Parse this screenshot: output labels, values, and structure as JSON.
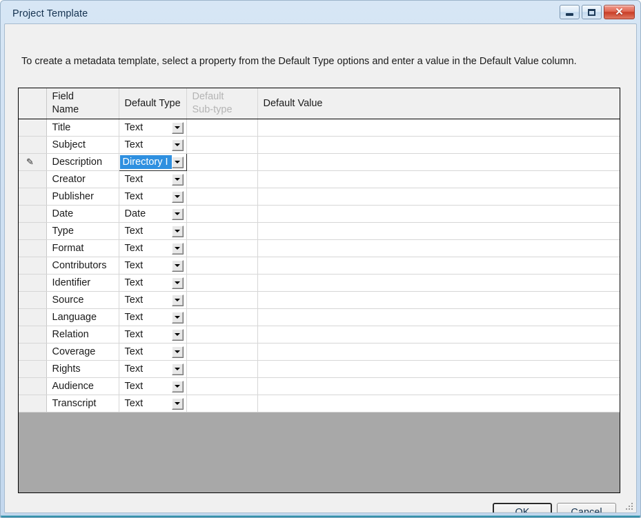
{
  "window": {
    "title": "Project Template",
    "caption_buttons": [
      {
        "name": "minimize-button",
        "glyph": "minimize"
      },
      {
        "name": "maximize-button",
        "glyph": "maximize"
      },
      {
        "name": "close-button",
        "glyph": "✕"
      }
    ]
  },
  "instruction": "To create a metadata template, select a property from the Default Type options and enter a value in the Default Value column.",
  "grid": {
    "columns": [
      {
        "key": "rowhdr",
        "label": "",
        "disabled": false
      },
      {
        "key": "field",
        "label": "Field\nName",
        "line1": "Field",
        "line2": "Name",
        "disabled": false
      },
      {
        "key": "type",
        "label": "Default Type",
        "disabled": false
      },
      {
        "key": "sub",
        "label": "Default Sub-type",
        "line1": "Default",
        "line2": "Sub-type",
        "disabled": true
      },
      {
        "key": "value",
        "label": "Default Value",
        "disabled": false
      }
    ],
    "rows": [
      {
        "field": "Title",
        "type": "Text",
        "sub": "",
        "value": "",
        "editing": false
      },
      {
        "field": "Subject",
        "type": "Text",
        "sub": "",
        "value": "",
        "editing": false
      },
      {
        "field": "Description",
        "type": "Directory I",
        "sub": "",
        "value": "",
        "editing": true
      },
      {
        "field": "Creator",
        "type": "Text",
        "sub": "",
        "value": "",
        "editing": false
      },
      {
        "field": "Publisher",
        "type": "Text",
        "sub": "",
        "value": "",
        "editing": false
      },
      {
        "field": "Date",
        "type": "Date",
        "sub": "",
        "value": "",
        "editing": false
      },
      {
        "field": "Type",
        "type": "Text",
        "sub": "",
        "value": "",
        "editing": false
      },
      {
        "field": "Format",
        "type": "Text",
        "sub": "",
        "value": "",
        "editing": false
      },
      {
        "field": "Contributors",
        "type": "Text",
        "sub": "",
        "value": "",
        "editing": false
      },
      {
        "field": "Identifier",
        "type": "Text",
        "sub": "",
        "value": "",
        "editing": false
      },
      {
        "field": "Source",
        "type": "Text",
        "sub": "",
        "value": "",
        "editing": false
      },
      {
        "field": "Language",
        "type": "Text",
        "sub": "",
        "value": "",
        "editing": false
      },
      {
        "field": "Relation",
        "type": "Text",
        "sub": "",
        "value": "",
        "editing": false
      },
      {
        "field": "Coverage",
        "type": "Text",
        "sub": "",
        "value": "",
        "editing": false
      },
      {
        "field": "Rights",
        "type": "Text",
        "sub": "",
        "value": "",
        "editing": false
      },
      {
        "field": "Audience",
        "type": "Text",
        "sub": "",
        "value": "",
        "editing": false
      },
      {
        "field": "Transcript",
        "type": "Text",
        "sub": "",
        "value": "",
        "editing": false
      }
    ],
    "edit_indicator_glyph": "✎"
  },
  "footer": {
    "ok_label": "OK",
    "cancel_label": "Cancel"
  },
  "colors": {
    "selection_blue": "#2f90e0",
    "disabled_header": "#b4b4b4",
    "grid_empty_area": "#a8a8a8",
    "dialog_background": "#f0f0f0",
    "close_button_red": "#c83d26"
  }
}
